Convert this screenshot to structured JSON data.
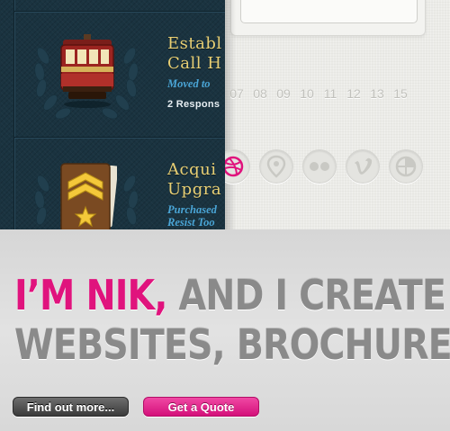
{
  "achievements": [
    {
      "title": "Establ",
      "title2": "Call H",
      "subtitle": "Moved to",
      "responses": "2 Respons",
      "icon": "cable-car-icon"
    },
    {
      "title": "Acqui",
      "title2": "Upgra",
      "subtitle": "Purchased",
      "subtitle2": "Resist Too",
      "icon": "rank-chevron-icon"
    }
  ],
  "calendar": {
    "numbers": [
      "07",
      "08",
      "09",
      "10",
      "11",
      "12",
      "13",
      "15"
    ]
  },
  "social": [
    {
      "name": "dribbble-icon",
      "color": "#e0137d"
    },
    {
      "name": "location-pin-icon",
      "color": "#c9c9c4"
    },
    {
      "name": "flickr-icon",
      "color": "#c9c9c4"
    },
    {
      "name": "vimeo-icon",
      "color": "#c9c9c4"
    },
    {
      "name": "quadrant-icon",
      "color": "#c9c9c4"
    }
  ],
  "banner": {
    "line1_pink": "I’M NIK,",
    "line1_grey": " AND I CREATE",
    "line2_grey": "WEBSITES, BROCHURE",
    "find_out_more": "Find out more...",
    "get_quote": "Get a Quote"
  },
  "colors": {
    "accent_pink": "#e0137d",
    "dark_panel": "#1a3340",
    "gold": "#e8cf74",
    "link_blue": "#4aa5d6"
  }
}
